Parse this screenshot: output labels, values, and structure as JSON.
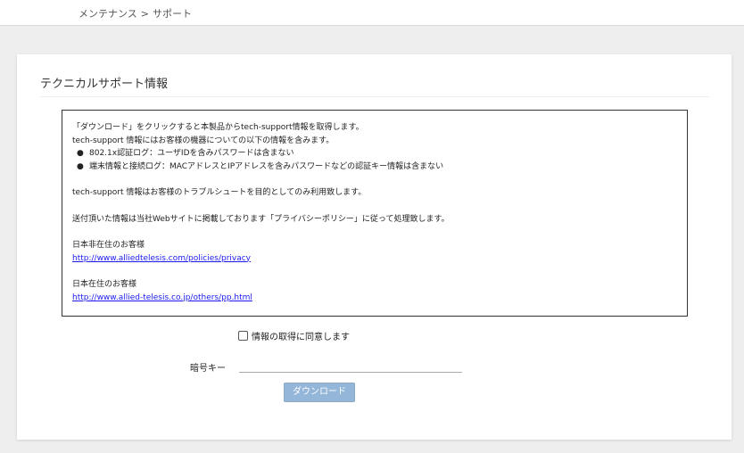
{
  "breadcrumb": {
    "parent": "メンテナンス",
    "separator": ">",
    "current": "サポート"
  },
  "page": {
    "title": "テクニカルサポート情報"
  },
  "info": {
    "line1": "「ダウンロード」をクリックすると本製品からtech-support情報を取得します。",
    "line2": "tech-support 情報にはお客様の機器についての以下の情報を含みます。",
    "bullets": [
      "802.1x認証ログ：ユーザIDを含みパスワードは含まない",
      "端末情報と接続ログ：MACアドレスとIPアドレスを含みパスワードなどの認証キー情報は含まない"
    ],
    "usage": "tech-support 情報はお客様のトラブルシュートを目的としてのみ利用致します。",
    "privacy": "送付頂いた情報は当社Webサイトに掲載しております「プライバシーポリシー」に従って処理致します。",
    "overseas_label": "日本非在住のお客様",
    "overseas_link": "http://www.alliedtelesis.com/policies/privacy",
    "domestic_label": "日本在住のお客様",
    "domestic_link": "http://www.allied-telesis.co.jp/others/pp.html"
  },
  "form": {
    "agree_label": "情報の取得に同意します",
    "agree_checked": false,
    "key_label": "暗号キー",
    "key_value": "",
    "download_label": "ダウンロード"
  },
  "colors": {
    "button_disabled": "#94b6d8",
    "link": "#1a1aee",
    "background": "#eeeeee"
  }
}
